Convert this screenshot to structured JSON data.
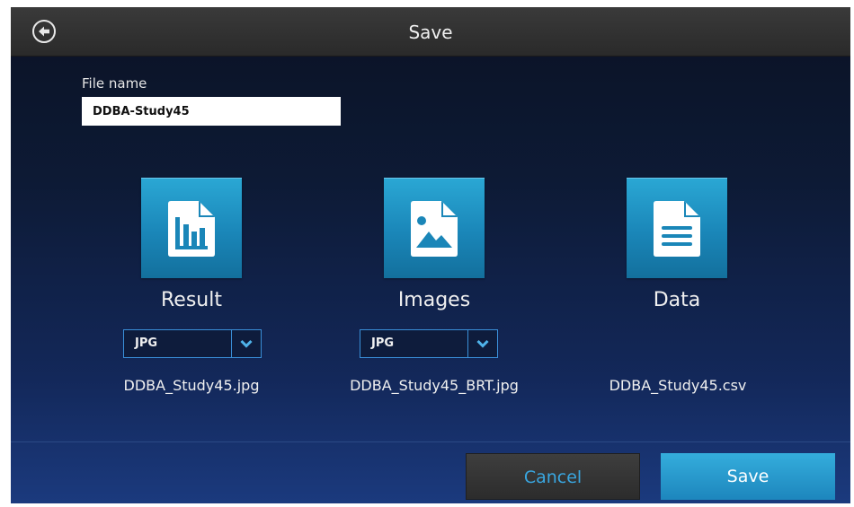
{
  "header": {
    "title": "Save",
    "back_icon": "arrow-left-circle-icon"
  },
  "file": {
    "label": "File name",
    "value": "DDBA-Study45"
  },
  "options": [
    {
      "label": "Result",
      "icon": "chart-document-icon",
      "format": "JPG",
      "filename": "DDBA_Study45.jpg"
    },
    {
      "label": "Images",
      "icon": "image-document-icon",
      "format": "JPG",
      "filename": "DDBA_Study45_BRT.jpg"
    },
    {
      "label": "Data",
      "icon": "text-document-icon",
      "filename": "DDBA_Study45.csv"
    }
  ],
  "footer": {
    "cancel_label": "Cancel",
    "save_label": "Save"
  },
  "colors": {
    "accent": "#2aa7d4",
    "cancel_text": "#39a6e0",
    "select_border": "#3a8fd8"
  }
}
